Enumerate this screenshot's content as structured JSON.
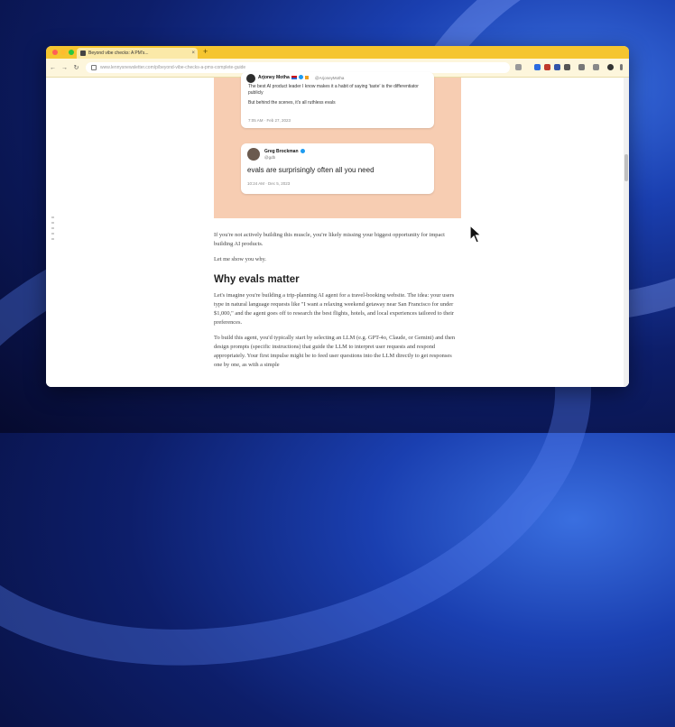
{
  "browser": {
    "tab_title": "Beyond vibe checks: A PM's...",
    "url": "www.lennysnewsletter.com/p/beyond-vibe-checks-a-pms-complete-guide"
  },
  "tweets": [
    {
      "name": "Arjoney Motha",
      "handle": "@ArjoneyMotha",
      "text_1": "The best AI product leader I know makes it a habit of saying 'taste' is the differentiator publicly",
      "text_2": "But behind the scenes, it's all ruthless evals",
      "date": "7:05 AM · Feb 27, 2023"
    },
    {
      "name": "Greg Brockman",
      "handle": "@gdb",
      "text": "evals are surprisingly often all you need",
      "date": "10:24 AM · Dec 5, 2023"
    }
  ],
  "article": {
    "intro": "If you're not actively building this muscle, you're likely missing your biggest opportunity for impact building AI products.",
    "lead": "Let me show you why.",
    "heading": "Why evals matter",
    "para_1": "Let's imagine you're building a trip-planning AI agent for a travel-booking website. The idea: your users type in natural language requests like \"I want a relaxing weekend getaway near San Francisco for under $1,000,\" and the agent goes off to research the best flights, hotels, and local experiences tailored to their preferences.",
    "para_2": "To build this agent, you'd typically start by selecting an LLM (e.g. GPT-4o, Claude, or Gemini) and then design prompts (specific instructions) that guide the LLM to interpret user requests and respond appropriately. Your first impulse might be to feed user questions into the LLM directly to get responses one by one, as with a simple"
  },
  "colors": {
    "tab_bar": "#f5c530",
    "tweet_card_bg": "#f7cdb2"
  }
}
